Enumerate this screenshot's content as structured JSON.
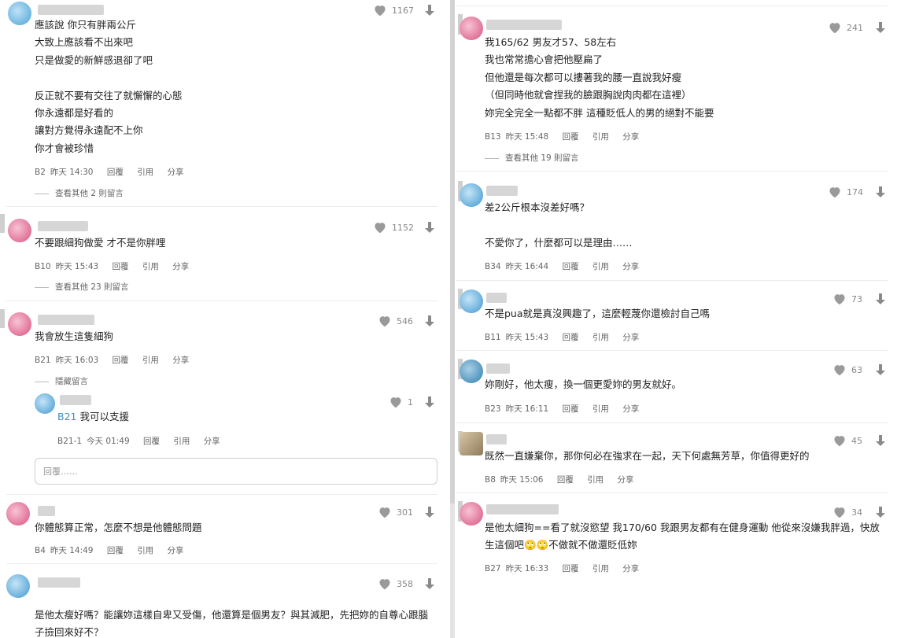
{
  "left": {
    "comments": [
      {
        "id": "B2",
        "body": "應該說 你只有胖兩公斤\n大致上應該看不出來吧\n只是做愛的新鮮感退卻了吧\n\n反正就不要有交往了就懈懈的心態\n你永遠都是好看的\n讓對方覺得永遠配不上你\n你才會被珍惜",
        "meta_floor": "B2",
        "meta_time": "昨天 14:30",
        "likes": "1167",
        "more": "查看其他 2 則留言"
      },
      {
        "id": "B10",
        "body": "不要跟細狗做愛 才不是你胖哩",
        "meta_floor": "B10",
        "meta_time": "昨天 15:43",
        "likes": "1152",
        "more": "查看其他 23 則留言"
      },
      {
        "id": "B21",
        "body": "我會放生這隻細狗",
        "meta_floor": "B21",
        "meta_time": "昨天 16:03",
        "likes": "546",
        "more": "隱藏留言"
      },
      {
        "id": "B4",
        "body": "你體態算正常，怎麼不想是他體態問題",
        "meta_floor": "B4",
        "meta_time": "昨天 14:49",
        "likes": "301"
      },
      {
        "id": "B5x",
        "body": "是他太瘦好嗎？能讓妳這樣自卑又受傷，他還算是個男友？與其減肥，先把妳的自尊心跟腦\n子撿回來好不？",
        "likes": "358"
      }
    ],
    "reply": {
      "ref": "B21",
      "text": " 我可以支援",
      "meta_floor": "B21-1",
      "meta_time": "今天 01:49",
      "likes": "1"
    },
    "reply_placeholder": "回覆……"
  },
  "right": {
    "comments": [
      {
        "id": "B13",
        "body": "我165/62 男友才57、58左右\n我也常常擔心會把他壓扁了\n但他還是每次都可以摟著我的腰一直說我好瘦\n（但同時他就會捏我的臉跟胸說肉肉都在這裡）\n妳完全完全一點都不胖 這種貶低人的男的絕對不能要",
        "meta_floor": "B13",
        "meta_time": "昨天 15:48",
        "likes": "241",
        "more": "查看其他 19 則留言"
      },
      {
        "id": "B34",
        "body": "差2公斤根本沒差好嗎？\n\n不愛你了，什麼都可以是理由……",
        "meta_floor": "B34",
        "meta_time": "昨天 16:44",
        "likes": "174"
      },
      {
        "id": "B11",
        "body": "不是pua就是真沒興趣了，這麼輕蔑你還檢討自己嗎",
        "meta_floor": "B11",
        "meta_time": "昨天 15:43",
        "likes": "73"
      },
      {
        "id": "B23",
        "body": "妳剛好，他太瘦，換一個更愛妳的男友就好。",
        "meta_floor": "B23",
        "meta_time": "昨天 16:11",
        "likes": "63"
      },
      {
        "id": "B8",
        "body": "既然一直嫌棄你，那你何必在強求在一起，天下何處無芳草，你值得更好的",
        "meta_floor": "B8",
        "meta_time": "昨天 15:06",
        "likes": "45"
      },
      {
        "id": "B27",
        "body": "是他太細狗==看了就沒慾望 我170/60 我跟男友都有在健身運動 他從來沒嫌我胖過，快放\n生這個吧🙄🙄不做就不做還貶低妳",
        "meta_floor": "B27",
        "meta_time": "昨天 16:33",
        "likes": "34"
      }
    ]
  },
  "actions": {
    "reply": "回覆",
    "quote": "引用",
    "share": "分享"
  },
  "icons": {
    "like": "heart-icon",
    "dislike": "arrow-down-icon"
  },
  "colors": {
    "accent": "#3f8fc4",
    "text": "#222222",
    "muted": "#666666"
  }
}
